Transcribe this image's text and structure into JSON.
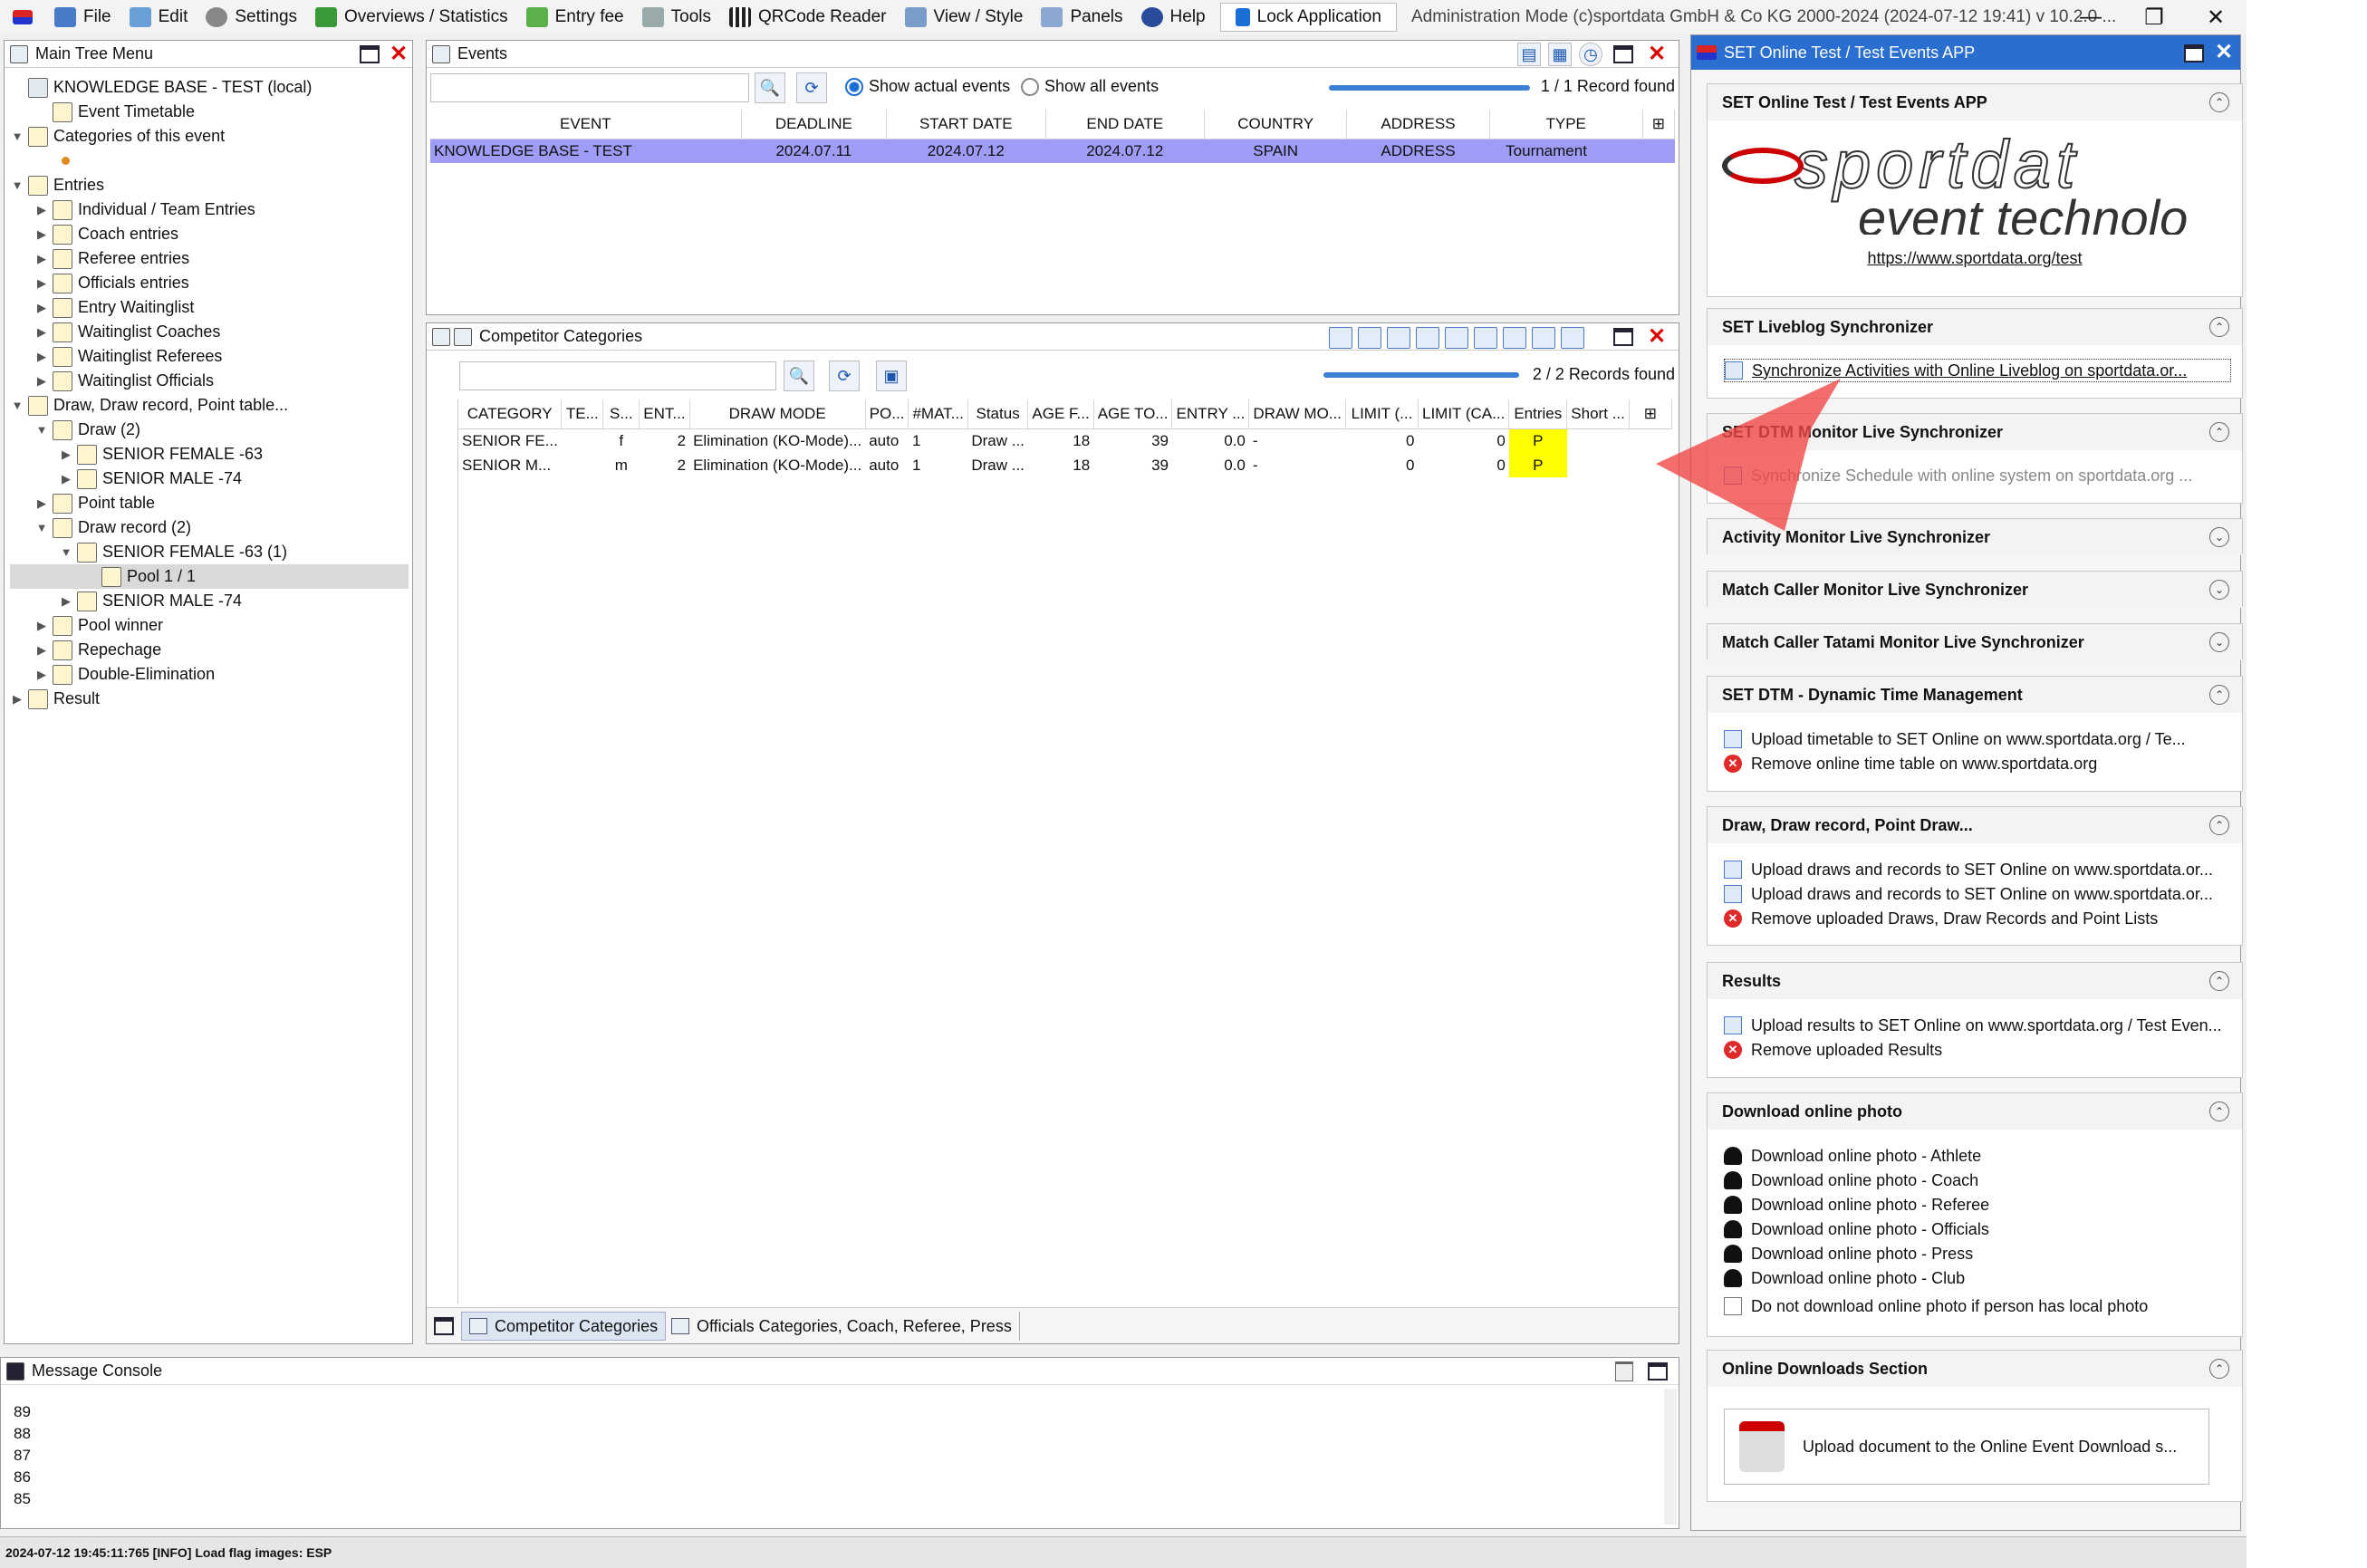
{
  "menubar": {
    "items": [
      "File",
      "Edit",
      "Settings",
      "Overviews / Statistics",
      "Entry fee",
      "Tools",
      "QRCode Reader",
      "View / Style",
      "Panels",
      "Help"
    ],
    "lock_label": "Lock Application",
    "title": "Administration Mode (c)sportdata GmbH & Co KG 2000-2024 (2024-07-12 19:41)  v 10.2.0 ...",
    "minimize": "—",
    "restore": "❐",
    "close": "✕"
  },
  "tree_panel": {
    "title": "Main Tree Menu",
    "nodes": [
      {
        "label": "KNOWLEDGE BASE - TEST (local)",
        "toggle": ""
      },
      {
        "label": "Event Timetable",
        "toggle": ""
      },
      {
        "label": "Categories of this event",
        "toggle": "▼"
      },
      {
        "label": "",
        "toggle": ""
      },
      {
        "label": "Entries",
        "toggle": "▼"
      },
      {
        "label": "Individual / Team Entries",
        "toggle": "▶"
      },
      {
        "label": "Coach entries",
        "toggle": "▶"
      },
      {
        "label": "Referee entries",
        "toggle": "▶"
      },
      {
        "label": "Officials entries",
        "toggle": "▶"
      },
      {
        "label": "Entry Waitinglist",
        "toggle": "▶"
      },
      {
        "label": "Waitinglist Coaches",
        "toggle": "▶"
      },
      {
        "label": "Waitinglist Referees",
        "toggle": "▶"
      },
      {
        "label": "Waitinglist Officials",
        "toggle": "▶"
      },
      {
        "label": "Draw, Draw record, Point table...",
        "toggle": "▼"
      },
      {
        "label": "Draw (2)",
        "toggle": "▼"
      },
      {
        "label": "SENIOR FEMALE -63",
        "toggle": "▶"
      },
      {
        "label": "SENIOR MALE -74",
        "toggle": "▶"
      },
      {
        "label": "Point table",
        "toggle": "▶"
      },
      {
        "label": "Draw record (2)",
        "toggle": "▼"
      },
      {
        "label": "SENIOR FEMALE -63 (1)",
        "toggle": "▼"
      },
      {
        "label": "Pool 1 / 1",
        "toggle": ""
      },
      {
        "label": "SENIOR MALE -74",
        "toggle": "▶"
      },
      {
        "label": "Pool winner",
        "toggle": "▶"
      },
      {
        "label": "Repechage",
        "toggle": "▶"
      },
      {
        "label": "Double-Elimination",
        "toggle": "▶"
      },
      {
        "label": "Result",
        "toggle": "▶"
      }
    ]
  },
  "events_panel": {
    "title": "Events",
    "radio_actual": "Show actual events",
    "radio_all": "Show all events",
    "progress_label": "100%",
    "records": "1 / 1 Record found",
    "columns": [
      "EVENT",
      "DEADLINE",
      "START DATE",
      "END DATE",
      "COUNTRY",
      "ADDRESS",
      "TYPE"
    ],
    "rows": [
      [
        "KNOWLEDGE BASE - TEST",
        "2024.07.11",
        "2024.07.12",
        "2024.07.12",
        "SPAIN",
        "ADDRESS",
        "Tournament"
      ]
    ]
  },
  "categories_panel": {
    "title": "Competitor Categories",
    "progress_label": "100%",
    "records": "2 / 2 Records found",
    "columns": [
      "CATEGORY",
      "TE...",
      "S...",
      "ENT...",
      "DRAW MODE",
      "PO...",
      "#MAT...",
      "Status",
      "AGE F...",
      "AGE TO...",
      "ENTRY ...",
      "DRAW MO...",
      "LIMIT (...",
      "LIMIT (CA...",
      "Entries",
      "Short ..."
    ],
    "rows": [
      [
        "SENIOR FE...",
        "",
        "f",
        "2",
        "Elimination (KO-Mode)...",
        "auto",
        "1",
        "Draw ...",
        "18",
        "39",
        "0.0",
        "-",
        "0",
        "0",
        "P",
        ""
      ],
      [
        "SENIOR M...",
        "",
        "m",
        "2",
        "Elimination (KO-Mode)...",
        "auto",
        "1",
        "Draw ...",
        "18",
        "39",
        "0.0",
        "-",
        "0",
        "0",
        "P",
        ""
      ]
    ],
    "tabs": [
      "Competitor Categories",
      "Officials Categories, Coach, Referee, Press"
    ]
  },
  "console_panel": {
    "title": "Message Console",
    "lines": [
      "89",
      "88",
      "87",
      "86",
      "85"
    ]
  },
  "status_bar": "2024-07-12 19:45:11:765 [INFO] Load flag images: ESP",
  "right_panel": {
    "title": "SET Online Test / Test Events APP",
    "sections": {
      "app": {
        "title": "SET Online Test / Test Events APP",
        "logo_top": "sportdat",
        "logo_bottom": "event technolo",
        "link": "https://www.sportdata.org/test"
      },
      "liveblog": {
        "title": "SET Liveblog Synchronizer",
        "item": "Synchronize Activities with Online Liveblog on sportdata.or..."
      },
      "dtm_monitor": {
        "title": "SET DTM Monitor Live Synchronizer",
        "item": "Synchronize Schedule with online system on sportdata.org ..."
      },
      "activity": {
        "title": "Activity Monitor Live Synchronizer"
      },
      "match_caller": {
        "title": "Match Caller Monitor Live Synchronizer"
      },
      "match_tatami": {
        "title": "Match Caller Tatami Monitor Live Synchronizer"
      },
      "dtm": {
        "title": "SET DTM - Dynamic Time Management",
        "items": [
          "Upload timetable to SET Online on www.sportdata.org / Te...",
          "Remove online time table on www.sportdata.org"
        ]
      },
      "draw": {
        "title": "Draw, Draw record, Point Draw...",
        "items": [
          "Upload draws and records to SET Online on www.sportdata.or...",
          "Upload draws and records to SET Online on www.sportdata.or...",
          "Remove uploaded Draws, Draw Records and Point Lists"
        ]
      },
      "results": {
        "title": "Results",
        "items": [
          "Upload results to SET Online on www.sportdata.org / Test Even...",
          "Remove uploaded Results"
        ]
      },
      "photo": {
        "title": "Download online photo",
        "items": [
          "Download online photo - Athlete",
          "Download online photo - Coach",
          "Download online photo - Referee",
          "Download online photo - Officials",
          "Download online photo - Press",
          "Download online photo - Club"
        ],
        "checkbox": "Do not download online photo if person has local photo"
      },
      "downloads": {
        "title": "Online Downloads Section",
        "button": "Upload document to the Online Event Download s..."
      }
    }
  },
  "colors": {
    "selection": "#9e9cf5",
    "highlight": "#ffff00",
    "accent": "#3b7fd6",
    "close_red": "#d00000",
    "overlay_arrow": "#f04848"
  }
}
